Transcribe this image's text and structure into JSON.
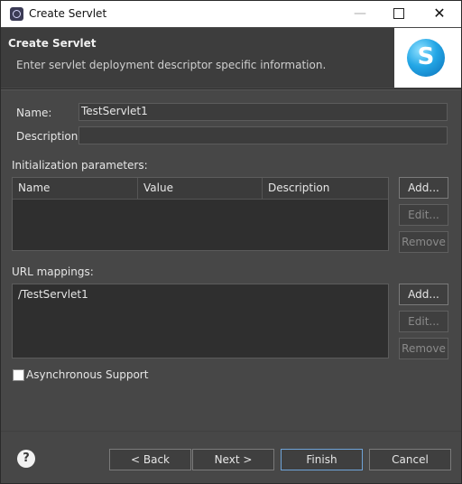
{
  "window": {
    "title": "Create Servlet",
    "minimize": "—",
    "close": "✕"
  },
  "banner": {
    "title": "Create Servlet",
    "subtitle": "Enter servlet deployment descriptor specific information.",
    "logo_letter": "S"
  },
  "form": {
    "name_label": "Name:",
    "name_value": "TestServlet1",
    "description_label": "Description:",
    "description_value": ""
  },
  "init_params": {
    "label": "Initialization parameters:",
    "columns": [
      "Name",
      "Value",
      "Description"
    ],
    "buttons": {
      "add": "Add...",
      "edit": "Edit...",
      "remove": "Remove"
    }
  },
  "url_mappings": {
    "label": "URL mappings:",
    "items": [
      "/TestServlet1"
    ],
    "buttons": {
      "add": "Add...",
      "edit": "Edit...",
      "remove": "Remove"
    }
  },
  "async_support": {
    "label": "Asynchronous Support",
    "checked": false
  },
  "footer": {
    "help": "?",
    "back": "< Back",
    "next": "Next >",
    "finish": "Finish",
    "cancel": "Cancel"
  }
}
